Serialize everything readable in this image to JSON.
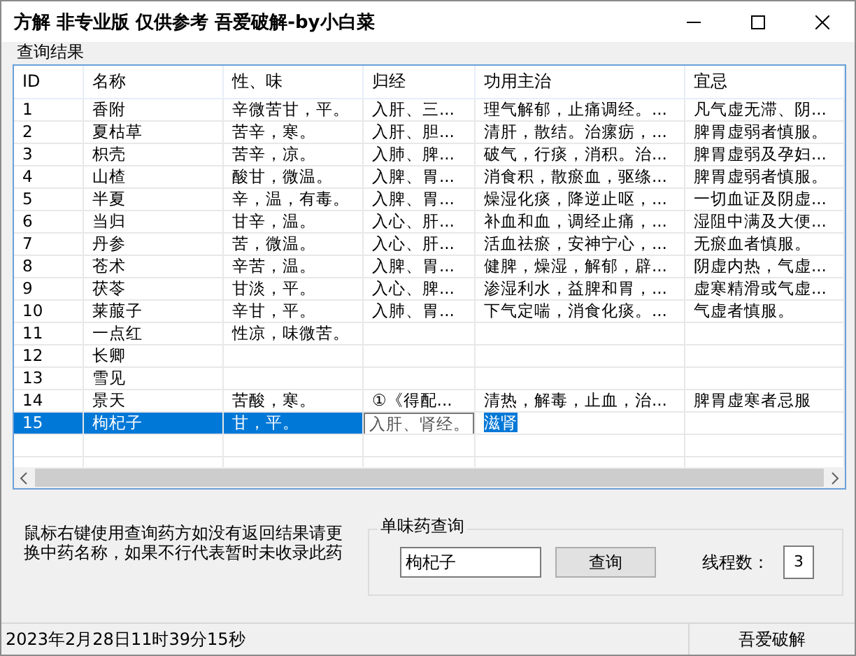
{
  "window": {
    "title": "方解 非专业版  仅供参考 吾爱破解-by小白菜"
  },
  "results": {
    "title": "查询结果",
    "columns": [
      "ID",
      "名称",
      "性、味",
      "归经",
      "功用主治",
      "宜忌"
    ],
    "rows": [
      {
        "cells": [
          "1",
          "香附",
          "辛微苦甘，平。",
          "入肝、三...",
          "理气解郁，止痛调经。...",
          "凡气虚无滞、阴..."
        ],
        "selected": false,
        "editing": false
      },
      {
        "cells": [
          "2",
          "夏枯草",
          "苦辛，寒。",
          "入肝、胆...",
          "清肝，散结。治瘰疬，...",
          "脾胃虚弱者慎服。"
        ],
        "selected": false,
        "editing": false
      },
      {
        "cells": [
          "3",
          "枳壳",
          "苦辛，凉。",
          "入肺、脾...",
          "破气，行痰，消积。治...",
          "脾胃虚弱及孕妇..."
        ],
        "selected": false,
        "editing": false
      },
      {
        "cells": [
          "4",
          "山楂",
          "酸甘，微温。",
          "入脾、胃...",
          "消食积，散瘀血，驱绦...",
          "脾胃虚弱者慎服。"
        ],
        "selected": false,
        "editing": false
      },
      {
        "cells": [
          "5",
          "半夏",
          "辛，温，有毒。",
          "入脾、胃...",
          "燥湿化痰，降逆止呕，...",
          "一切血证及阴虚..."
        ],
        "selected": false,
        "editing": false
      },
      {
        "cells": [
          "6",
          "当归",
          "甘辛，温。",
          "入心、肝...",
          "补血和血，调经止痛，...",
          "湿阻中满及大便..."
        ],
        "selected": false,
        "editing": false
      },
      {
        "cells": [
          "7",
          "丹参",
          "苦，微温。",
          "入心、肝...",
          "活血祛瘀，安神宁心，...",
          "无瘀血者慎服。"
        ],
        "selected": false,
        "editing": false
      },
      {
        "cells": [
          "8",
          "苍术",
          "辛苦，温。",
          "入脾、胃...",
          "健脾，燥湿，解郁，辟...",
          "阴虚内热，气虚..."
        ],
        "selected": false,
        "editing": false
      },
      {
        "cells": [
          "9",
          "茯苓",
          "甘淡，平。",
          "入心、脾...",
          "渗湿利水，益脾和胃，...",
          "虚寒精滑或气虚..."
        ],
        "selected": false,
        "editing": false
      },
      {
        "cells": [
          "10",
          "莱菔子",
          "辛甘，平。",
          "入肺、胃...",
          "下气定喘，消食化痰。...",
          "气虚者慎服。"
        ],
        "selected": false,
        "editing": false
      },
      {
        "cells": [
          "11",
          "一点红",
          "性凉，味微苦。",
          "",
          "",
          ""
        ],
        "selected": false,
        "editing": false
      },
      {
        "cells": [
          "12",
          "长卿",
          "",
          "",
          "",
          ""
        ],
        "selected": false,
        "editing": false
      },
      {
        "cells": [
          "13",
          "雪见",
          "",
          "",
          "",
          ""
        ],
        "selected": false,
        "editing": false
      },
      {
        "cells": [
          "14",
          "景天",
          "苦酸，寒。",
          "①《得配...",
          "清热，解毒，止血，治...",
          "脾胃虚寒者忌服"
        ],
        "selected": false,
        "editing": false
      },
      {
        "cells": [
          "15",
          "枸杞子",
          "甘，平。",
          "入肝、肾经。",
          "滋肾",
          ""
        ],
        "selected": true,
        "editing": true
      }
    ]
  },
  "note": "鼠标右键使用查询药方如没有返回结果请更换中药名称，如果不行代表暂时未收录此药",
  "single_query": {
    "title": "单味药查询",
    "value": "枸杞子",
    "button": "查询",
    "threads_label": "线程数：",
    "threads_value": "3"
  },
  "status_bar": {
    "datetime": "2023年2月28日11时39分15秒",
    "right": "吾爱破解"
  }
}
